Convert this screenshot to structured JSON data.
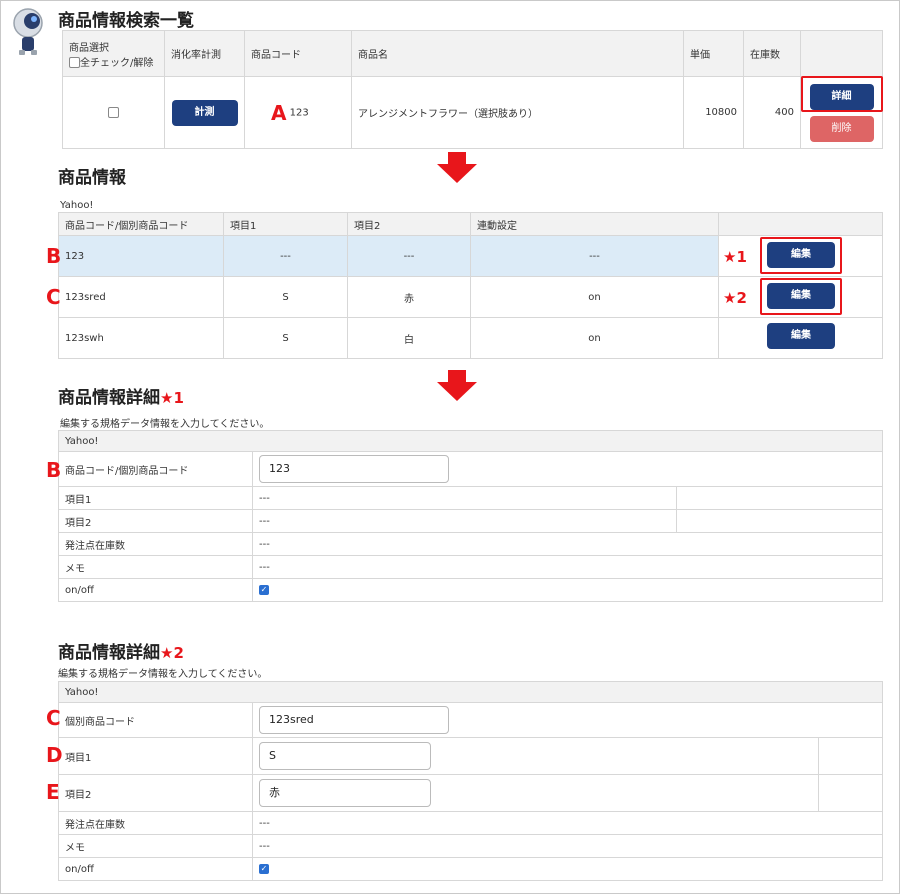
{
  "section1": {
    "title": "商品情報検索一覧",
    "headers": {
      "select": "商品選択",
      "check_all": "全チェック/解除",
      "measure": "消化率計測",
      "code": "商品コード",
      "name": "商品名",
      "price": "単価",
      "stock": "在庫数"
    },
    "row": {
      "measure_button": "計測",
      "code": "123",
      "name": "アレンジメントフラワー（選択肢あり）",
      "price": "10800",
      "stock": "400",
      "detail_button": "詳細",
      "delete_button": "削除"
    },
    "marker": "A"
  },
  "section2": {
    "title": "商品情報",
    "store": "Yahoo!",
    "headers": {
      "code": "商品コード/個別商品コード",
      "item1": "項目1",
      "item2": "項目2",
      "link": "連動設定"
    },
    "rows": [
      {
        "marker": "B",
        "code": "123",
        "item1": "---",
        "item2": "---",
        "link": "---",
        "star": "★1",
        "edit": "編集"
      },
      {
        "marker": "C",
        "code": "123sred",
        "item1": "S",
        "item2": "赤",
        "link": "on",
        "star": "★2",
        "edit": "編集"
      },
      {
        "marker": "",
        "code": "123swh",
        "item1": "S",
        "item2": "白",
        "link": "on",
        "star": "",
        "edit": "編集"
      }
    ]
  },
  "section3": {
    "title": "商品情報詳細",
    "star": "★1",
    "description": "編集する規格データ情報を入力してください。",
    "store": "Yahoo!",
    "marker": "B",
    "code_label": "商品コード/個別商品コード",
    "code_value": "123",
    "item1_label": "項目1",
    "item1_value": "---",
    "item2_label": "項目2",
    "item2_value": "---",
    "reorder_label": "発注点在庫数",
    "reorder_value": "---",
    "memo_label": "メモ",
    "memo_value": "---",
    "onoff_label": "on/off"
  },
  "section4": {
    "title": "商品情報詳細",
    "star": "★2",
    "description": "編集する規格データ情報を入力してください。",
    "store": "Yahoo!",
    "markers": {
      "code": "C",
      "item1": "D",
      "item2": "E"
    },
    "code_label": "個別商品コード",
    "code_value": "123sred",
    "item1_label": "項目1",
    "item1_value": "S",
    "item2_label": "項目2",
    "item2_value": "赤",
    "reorder_label": "発注点在庫数",
    "reorder_value": "---",
    "memo_label": "メモ",
    "memo_value": "---",
    "onoff_label": "on/off"
  },
  "colors": {
    "accent_red": "#e8161b",
    "button_blue": "#1e3f80",
    "button_delete": "#de6565",
    "highlight_row": "#dcebf7"
  },
  "icons": {
    "mascot": "robot-mascot-icon",
    "arrow": "arrow-down-icon",
    "checkbox": "checkbox-icon"
  }
}
